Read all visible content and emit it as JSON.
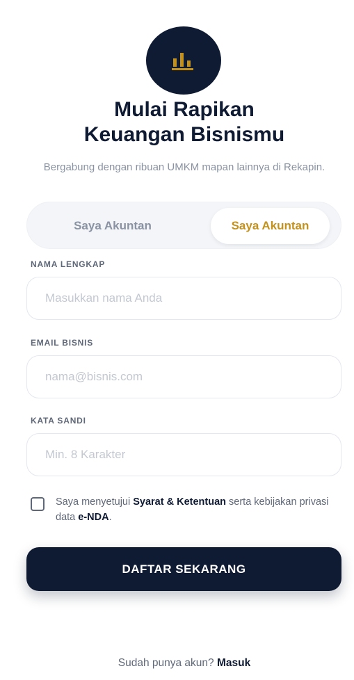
{
  "logo": {
    "icon": "bar-chart-icon",
    "accent_color": "#c4921c",
    "bg_color": "#0f1a33"
  },
  "header": {
    "title_line1": "Mulai Rapikan",
    "title_line2": "Keuangan Bisnismu",
    "subtitle": "Bergabung dengan ribuan UMKM mapan lainnya di Rekapin."
  },
  "toggle": {
    "left_label": "Saya Akuntan",
    "right_label": "Saya Akuntan",
    "active": "right"
  },
  "form": {
    "name_label": "NAMA LENGKAP",
    "name_placeholder": "Masukkan nama Anda",
    "email_label": "EMAIL BISNIS",
    "email_placeholder": "nama@bisnis.com",
    "password_label": "KATA SANDI",
    "password_placeholder": "Min. 8 Karakter"
  },
  "terms": {
    "prefix": "Saya menyetujui ",
    "link1": "Syarat & Ketentuan",
    "middle": " serta kebijakan privasi data ",
    "link2": "e-NDA",
    "suffix": ".",
    "checked": false
  },
  "cta": {
    "label": "DAFTAR SEKARANG"
  },
  "footer": {
    "prompt": "Sudah punya akun? ",
    "link": "Masuk"
  }
}
